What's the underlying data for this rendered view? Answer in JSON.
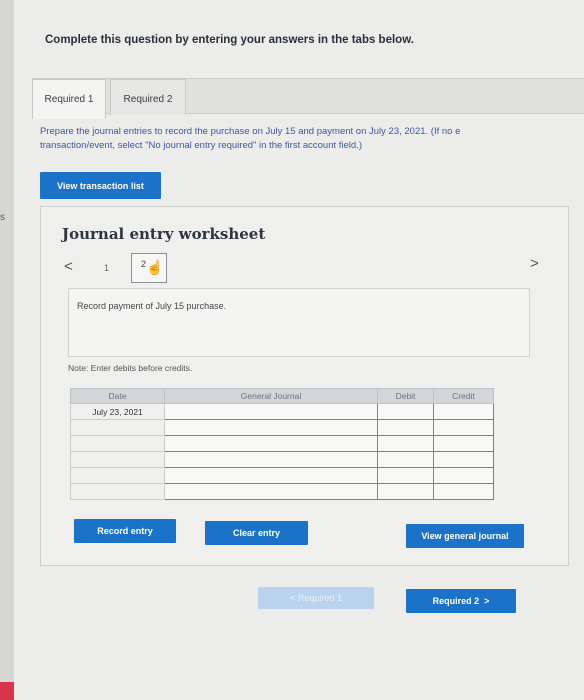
{
  "instruction": "Complete this question by entering your answers in the tabs below.",
  "tabs": [
    {
      "label": "Required 1"
    },
    {
      "label": "Required 2"
    }
  ],
  "prompt": {
    "line1": "Prepare the journal entries to record the purchase on July 15 and payment on July 23, 2021. (If no e",
    "line2": "transaction/event, select \"No journal entry required\" in the first account field.)"
  },
  "view_transaction_list": "View transaction list",
  "worksheet": {
    "title": "Journal entry worksheet",
    "pages": [
      "1",
      "2"
    ],
    "entry_description": "Record payment of July 15 purchase.",
    "note": "Note: Enter debits before credits."
  },
  "journal": {
    "headers": {
      "date": "Date",
      "general_journal": "General Journal",
      "debit": "Debit",
      "credit": "Credit"
    },
    "rows": [
      {
        "date": "July 23, 2021",
        "account": "",
        "debit": "",
        "credit": ""
      },
      {
        "date": "",
        "account": "",
        "debit": "",
        "credit": ""
      },
      {
        "date": "",
        "account": "",
        "debit": "",
        "credit": ""
      },
      {
        "date": "",
        "account": "",
        "debit": "",
        "credit": ""
      },
      {
        "date": "",
        "account": "",
        "debit": "",
        "credit": ""
      },
      {
        "date": "",
        "account": "",
        "debit": "",
        "credit": ""
      }
    ]
  },
  "buttons": {
    "record_entry": "Record entry",
    "clear_entry": "Clear entry",
    "view_general_journal": "View general journal",
    "prev_required": "Required 1",
    "next_required": "Required 2"
  },
  "edge_letter": "s",
  "colors": {
    "accent": "#1b73c9",
    "prompt_text": "#3b57a0",
    "disabled_button": "#b9d4ec"
  }
}
